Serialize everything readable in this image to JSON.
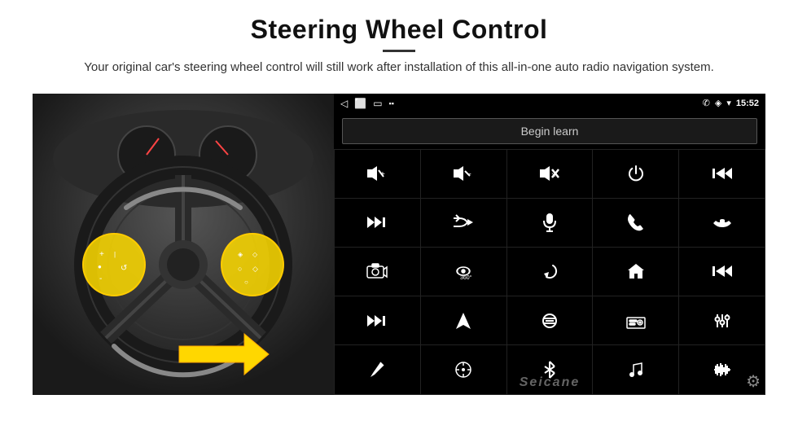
{
  "header": {
    "title": "Steering Wheel Control",
    "subtitle": "Your original car's steering wheel control will still work after installation of this all-in-one auto radio navigation system."
  },
  "statusBar": {
    "time": "15:52",
    "backIcon": "◁",
    "homeIcon": "□",
    "recentIcon": "▭",
    "signalIcon": "▪▪",
    "phoneIcon": "✆",
    "locationIcon": "◈",
    "wifiIcon": "▾"
  },
  "headunit": {
    "beginLearnLabel": "Begin learn",
    "watermark": "Seicane",
    "gridIcons": [
      {
        "id": "vol-up",
        "symbol": "🔊+",
        "row": 1,
        "col": 1
      },
      {
        "id": "vol-down",
        "symbol": "🔉-",
        "row": 1,
        "col": 2
      },
      {
        "id": "mute",
        "symbol": "🔇",
        "row": 1,
        "col": 3
      },
      {
        "id": "power",
        "symbol": "⏻",
        "row": 1,
        "col": 4
      },
      {
        "id": "prev-track",
        "symbol": "⏮",
        "row": 1,
        "col": 5
      },
      {
        "id": "next",
        "symbol": "⏭",
        "row": 2,
        "col": 1
      },
      {
        "id": "shuffle",
        "symbol": "⇌",
        "row": 2,
        "col": 2
      },
      {
        "id": "mic",
        "symbol": "🎤",
        "row": 2,
        "col": 3
      },
      {
        "id": "phone",
        "symbol": "📞",
        "row": 2,
        "col": 4
      },
      {
        "id": "hang-up",
        "symbol": "↩",
        "row": 2,
        "col": 5
      },
      {
        "id": "cam",
        "symbol": "📷",
        "row": 3,
        "col": 1
      },
      {
        "id": "360",
        "symbol": "360°",
        "row": 3,
        "col": 2
      },
      {
        "id": "back",
        "symbol": "↺",
        "row": 3,
        "col": 3
      },
      {
        "id": "home",
        "symbol": "⌂",
        "row": 3,
        "col": 4
      },
      {
        "id": "skip-back",
        "symbol": "⏮",
        "row": 3,
        "col": 5
      },
      {
        "id": "ff",
        "symbol": "⏭",
        "row": 4,
        "col": 1
      },
      {
        "id": "nav",
        "symbol": "➤",
        "row": 4,
        "col": 2
      },
      {
        "id": "eq",
        "symbol": "⇌",
        "row": 4,
        "col": 3
      },
      {
        "id": "radio",
        "symbol": "📻",
        "row": 4,
        "col": 4
      },
      {
        "id": "settings",
        "symbol": "⚙",
        "row": 4,
        "col": 5
      },
      {
        "id": "pen",
        "symbol": "✏",
        "row": 5,
        "col": 1
      },
      {
        "id": "compass",
        "symbol": "🧭",
        "row": 5,
        "col": 2
      },
      {
        "id": "bluetooth",
        "symbol": "⚡",
        "row": 5,
        "col": 3
      },
      {
        "id": "music",
        "symbol": "🎵",
        "row": 5,
        "col": 4
      },
      {
        "id": "equalizer",
        "symbol": "≋",
        "row": 5,
        "col": 5
      }
    ]
  }
}
